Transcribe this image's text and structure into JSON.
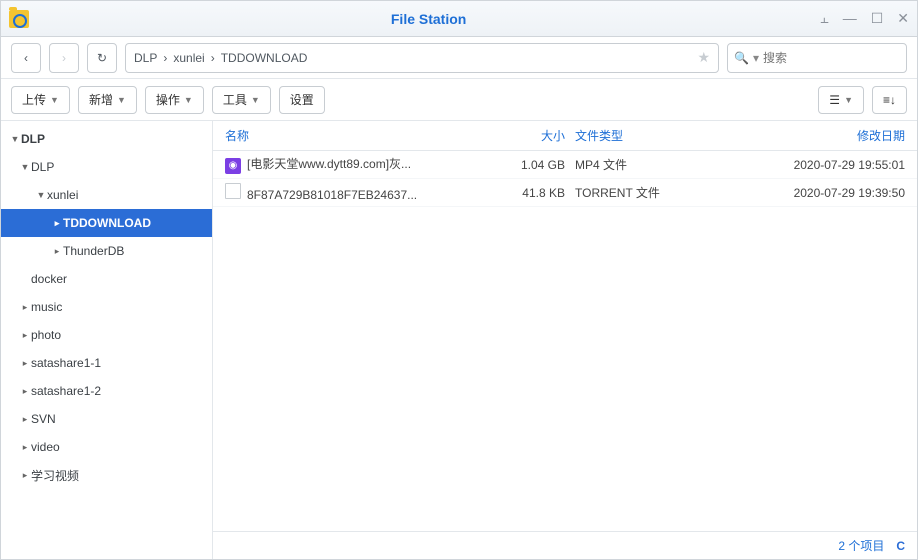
{
  "titlebar": {
    "title": "File Station"
  },
  "breadcrumb": {
    "parts": [
      "DLP",
      "xunlei",
      "TDDOWNLOAD"
    ]
  },
  "search": {
    "placeholder": "搜索"
  },
  "toolbar": {
    "upload": "上传",
    "create": "新增",
    "action": "操作",
    "tools": "工具",
    "settings": "设置"
  },
  "tree": {
    "root": "DLP",
    "items": [
      {
        "label": "DLP",
        "depth": 1,
        "expanded": true
      },
      {
        "label": "xunlei",
        "depth": 2,
        "expanded": true
      },
      {
        "label": "TDDOWNLOAD",
        "depth": 3,
        "selected": true,
        "leaf": true
      },
      {
        "label": "ThunderDB",
        "depth": 3,
        "leaf": true
      },
      {
        "label": "docker",
        "depth": 1,
        "noarrow": true
      },
      {
        "label": "music",
        "depth": 1
      },
      {
        "label": "photo",
        "depth": 1
      },
      {
        "label": "satashare1-1",
        "depth": 1
      },
      {
        "label": "satashare1-2",
        "depth": 1
      },
      {
        "label": "SVN",
        "depth": 1
      },
      {
        "label": "video",
        "depth": 1
      },
      {
        "label": "学习视频",
        "depth": 1
      }
    ]
  },
  "columns": {
    "name": "名称",
    "size": "大小",
    "type": "文件类型",
    "date": "修改日期"
  },
  "files": [
    {
      "icon": "mp4",
      "name": "[电影天堂www.dytt89.com]灰...",
      "size": "1.04 GB",
      "type": "MP4 文件",
      "date": "2020-07-29 19:55:01"
    },
    {
      "icon": "generic",
      "name": "8F87A729B81018F7EB24637...",
      "size": "41.8 KB",
      "type": "TORRENT 文件",
      "date": "2020-07-29 19:39:50"
    }
  ],
  "status": {
    "count": "2 个项目"
  }
}
